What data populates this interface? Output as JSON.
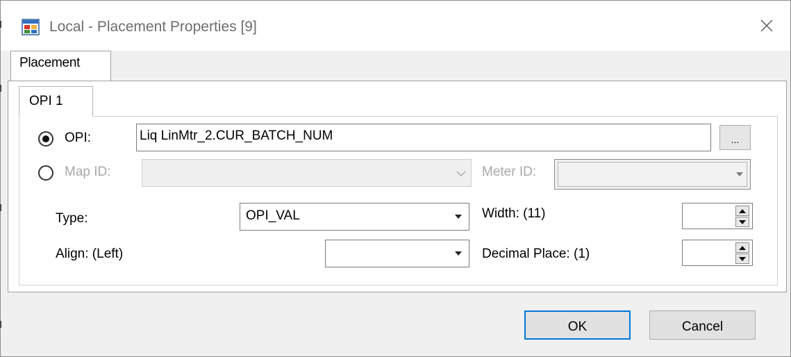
{
  "window": {
    "title": "Local - Placement Properties [9]",
    "app_icon": "window-app-icon",
    "close_icon": "close-icon"
  },
  "outer_tab": {
    "label": "Placement"
  },
  "inner_tab": {
    "label": "OPI 1"
  },
  "form": {
    "opi_label": "OPI:",
    "opi_value": "Liq LinMtr_2.CUR_BATCH_NUM",
    "browse_label": "...",
    "map_id_label": "Map ID:",
    "map_id_value": "",
    "meter_id_label": "Meter ID:",
    "meter_id_value": "",
    "type_label": "Type:",
    "type_value": "OPI_VAL",
    "align_label": "Align: (Left)",
    "align_value": "",
    "width_label": "Width: (11)",
    "width_value": "",
    "decimal_label": "Decimal Place: (1)",
    "decimal_value": "",
    "selected_source": "opi"
  },
  "buttons": {
    "ok": "OK",
    "cancel": "Cancel"
  },
  "colors": {
    "accent": "#0078d7",
    "disabled_text": "#a8a8a8",
    "dialog_bg": "#f0f0f0"
  }
}
